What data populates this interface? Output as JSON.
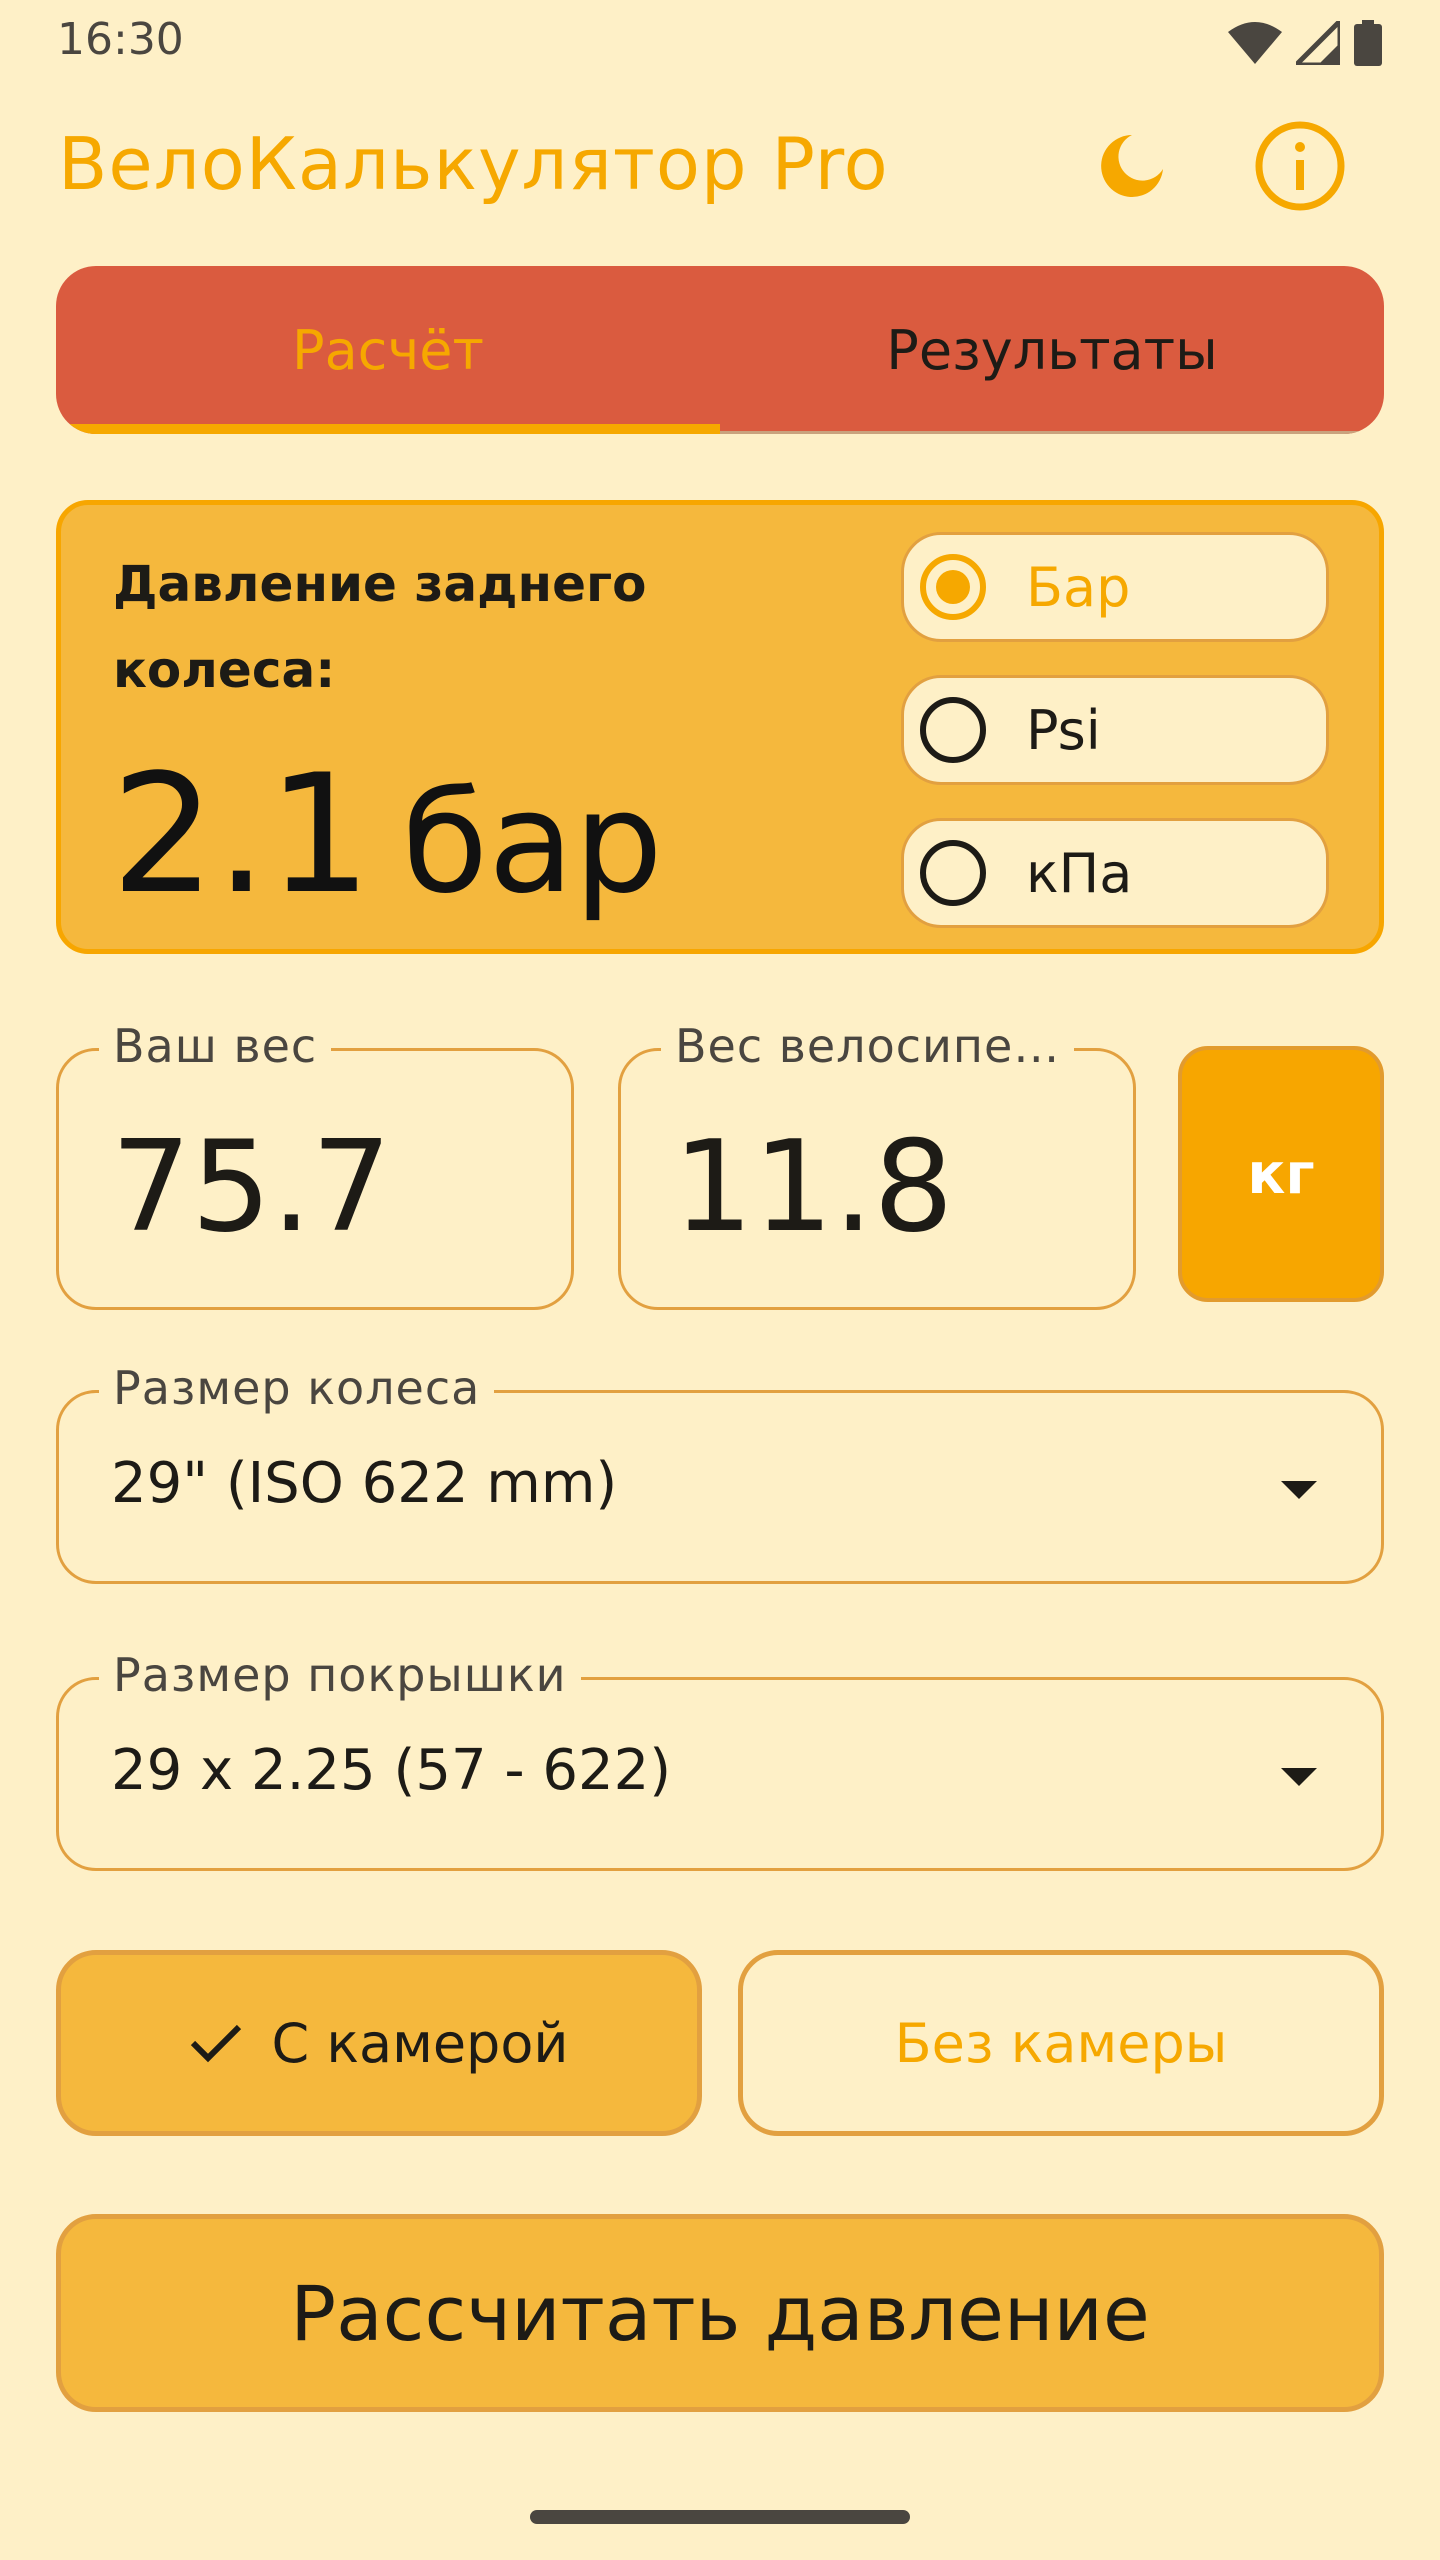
{
  "status_bar": {
    "time": "16:30"
  },
  "app_bar": {
    "title": "ВелоКалькулятор Pro",
    "icons": [
      "moon-icon",
      "info-icon"
    ]
  },
  "tabs": [
    {
      "label": "Расчёт",
      "selected": true
    },
    {
      "label": "Результаты",
      "selected": false
    }
  ],
  "pressure": {
    "label": "Давление заднего колеса:",
    "value": "2.1",
    "unit": "бар",
    "units": [
      {
        "label": "Бар",
        "selected": true
      },
      {
        "label": "Psi",
        "selected": false
      },
      {
        "label": "кПа",
        "selected": false
      }
    ]
  },
  "weights": {
    "rider_label": "Ваш вес",
    "rider_value": "75.7",
    "bike_label": "Вес велосипе…",
    "bike_value": "11.8",
    "unit_button": "кг"
  },
  "wheel_size": {
    "label": "Размер колеса",
    "value": "29\" (ISO 622 mm)"
  },
  "tire_size": {
    "label": "Размер покрышки",
    "value": "29 x 2.25 (57 - 622)"
  },
  "tube": {
    "with_label": "С камерой",
    "without_label": "Без камеры",
    "selected": "with"
  },
  "calculate_button": "Рассчитать давление",
  "colors": {
    "accent": "#F6A800",
    "background": "#FEF0C7",
    "tab_bar": "#DA5B3F",
    "card": "#F5B83D"
  }
}
